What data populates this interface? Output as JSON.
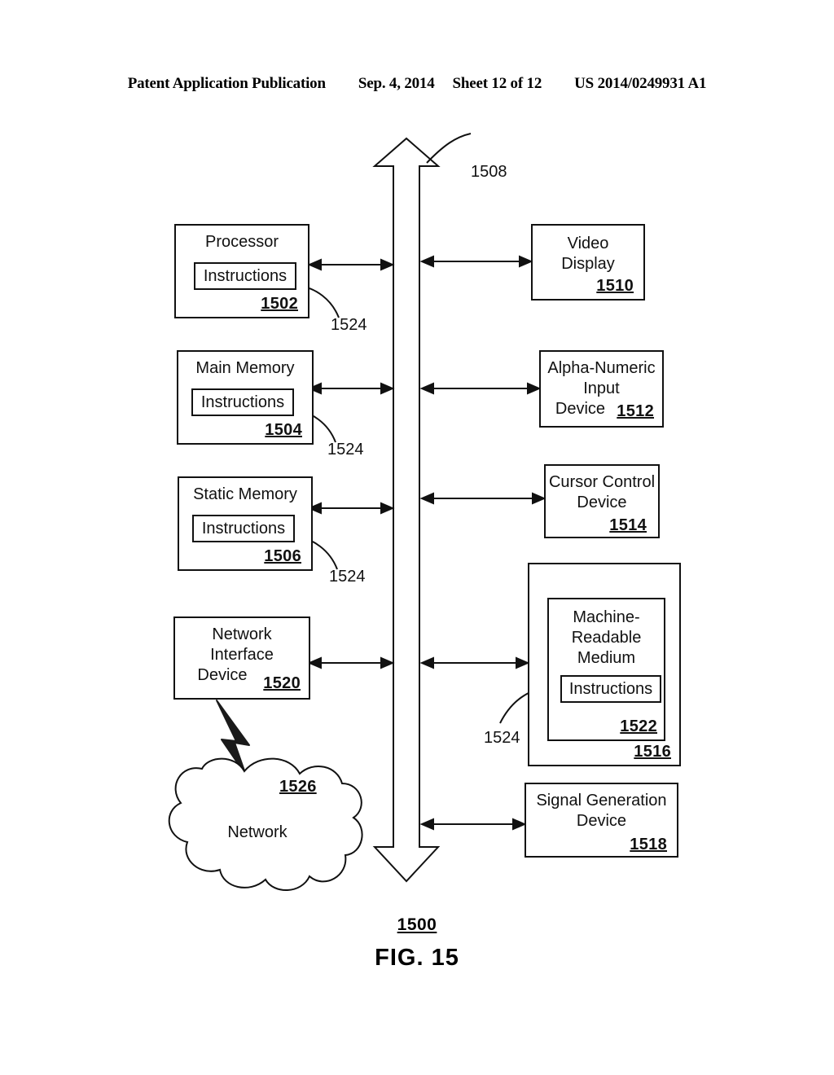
{
  "header": {
    "publication": "Patent Application Publication",
    "date": "Sep. 4, 2014",
    "sheet": "Sheet 12 of 12",
    "patent_number": "US 2014/0249931 A1"
  },
  "figure": {
    "caption": "FIG. 15",
    "system_ref": "1500",
    "bus_ref": "1508",
    "left_nodes": [
      {
        "title": "Processor",
        "ref": "1502",
        "inner_label": "Instructions",
        "leader_ref": "1524"
      },
      {
        "title": "Main Memory",
        "ref": "1504",
        "inner_label": "Instructions",
        "leader_ref": "1524"
      },
      {
        "title": "Static Memory",
        "ref": "1506",
        "inner_label": "Instructions",
        "leader_ref": "1524"
      },
      {
        "title_line1": "Network",
        "title_line2": "Interface",
        "title_line3": "Device",
        "ref": "1520"
      }
    ],
    "network_cloud": {
      "label": "Network",
      "ref": "1526"
    },
    "right_nodes": [
      {
        "title_line1": "Video",
        "title_line2": "Display",
        "ref": "1510"
      },
      {
        "title_line1": "Alpha-Numeric",
        "title_line2": "Input",
        "title_line3": "Device",
        "ref": "1512"
      },
      {
        "title_line1": "Cursor Control",
        "title_line2": "Device",
        "ref": "1514"
      },
      {
        "outer_ref": "1516",
        "title_line1": "Machine-",
        "title_line2": "Readable",
        "title_line3": "Medium",
        "inner_label": "Instructions",
        "medium_ref": "1522",
        "leader_ref": "1524"
      },
      {
        "title_line1": "Signal Generation",
        "title_line2": "Device",
        "ref": "1518"
      }
    ]
  }
}
